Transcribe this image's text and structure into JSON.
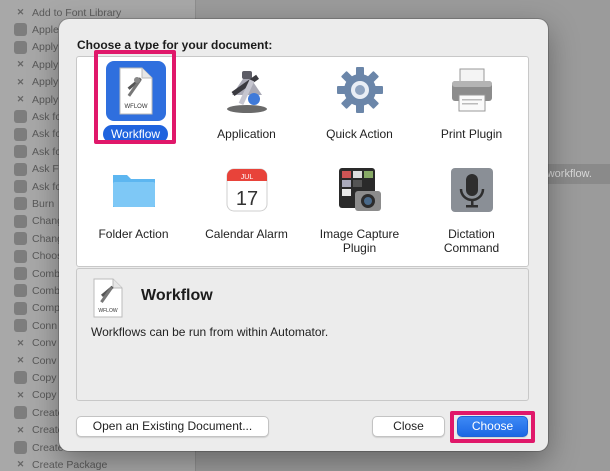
{
  "background": {
    "library_items": [
      {
        "label": "Add to Font Library",
        "icon": "x-icon"
      },
      {
        "label": "Apple",
        "icon": "app-icon"
      },
      {
        "label": "Apply",
        "icon": "app-icon"
      },
      {
        "label": "Apply",
        "icon": "x-icon"
      },
      {
        "label": "Apply",
        "icon": "x-icon"
      },
      {
        "label": "Apply",
        "icon": "x-icon"
      },
      {
        "label": "Ask fo",
        "icon": "app-icon"
      },
      {
        "label": "Ask fo",
        "icon": "app-icon"
      },
      {
        "label": "Ask fo",
        "icon": "app-icon"
      },
      {
        "label": "Ask F",
        "icon": "app-icon"
      },
      {
        "label": "Ask fo",
        "icon": "app-icon"
      },
      {
        "label": "Burn",
        "icon": "app-icon"
      },
      {
        "label": "Chang",
        "icon": "app-icon"
      },
      {
        "label": "Chang",
        "icon": "app-icon"
      },
      {
        "label": "Choos",
        "icon": "app-icon"
      },
      {
        "label": "Comb",
        "icon": "app-icon"
      },
      {
        "label": "Comb",
        "icon": "app-icon"
      },
      {
        "label": "Comp",
        "icon": "app-icon"
      },
      {
        "label": "Conn",
        "icon": "app-icon"
      },
      {
        "label": "Conv",
        "icon": "x-icon"
      },
      {
        "label": "Conv",
        "icon": "x-icon"
      },
      {
        "label": "Copy",
        "icon": "app-icon"
      },
      {
        "label": "Copy",
        "icon": "x-icon"
      },
      {
        "label": "Create",
        "icon": "app-icon"
      },
      {
        "label": "Create",
        "icon": "x-icon"
      },
      {
        "label": "Create",
        "icon": "app-icon"
      },
      {
        "label": "Create Package",
        "icon": "x-icon"
      }
    ],
    "hint_text": "r workflow."
  },
  "dialog": {
    "title": "Choose a type for your document:",
    "types": [
      {
        "label": "Workflow",
        "icon": "workflow-icon",
        "selected": true
      },
      {
        "label": "Application",
        "icon": "application-icon",
        "selected": false
      },
      {
        "label": "Quick Action",
        "icon": "gear-icon",
        "selected": false
      },
      {
        "label": "Print Plugin",
        "icon": "printer-icon",
        "selected": false
      },
      {
        "label": "Folder Action",
        "icon": "folder-icon",
        "selected": false
      },
      {
        "label": "Calendar Alarm",
        "icon": "calendar-icon",
        "selected": false
      },
      {
        "label": "Image Capture\nPlugin",
        "icon": "image-capture-icon",
        "selected": false
      },
      {
        "label": "Dictation\nCommand",
        "icon": "microphone-icon",
        "selected": false
      }
    ],
    "calendar_icon": {
      "month": "JUL",
      "day": "17"
    },
    "file_icon_text": "WFLOW",
    "description": {
      "title": "Workflow",
      "text": "Workflows can be run from within Automator."
    },
    "buttons": {
      "open_existing": "Open an Existing Document...",
      "close": "Close",
      "choose": "Choose"
    }
  },
  "colors": {
    "highlight": "#e0186a",
    "accent": "#1f63de"
  }
}
